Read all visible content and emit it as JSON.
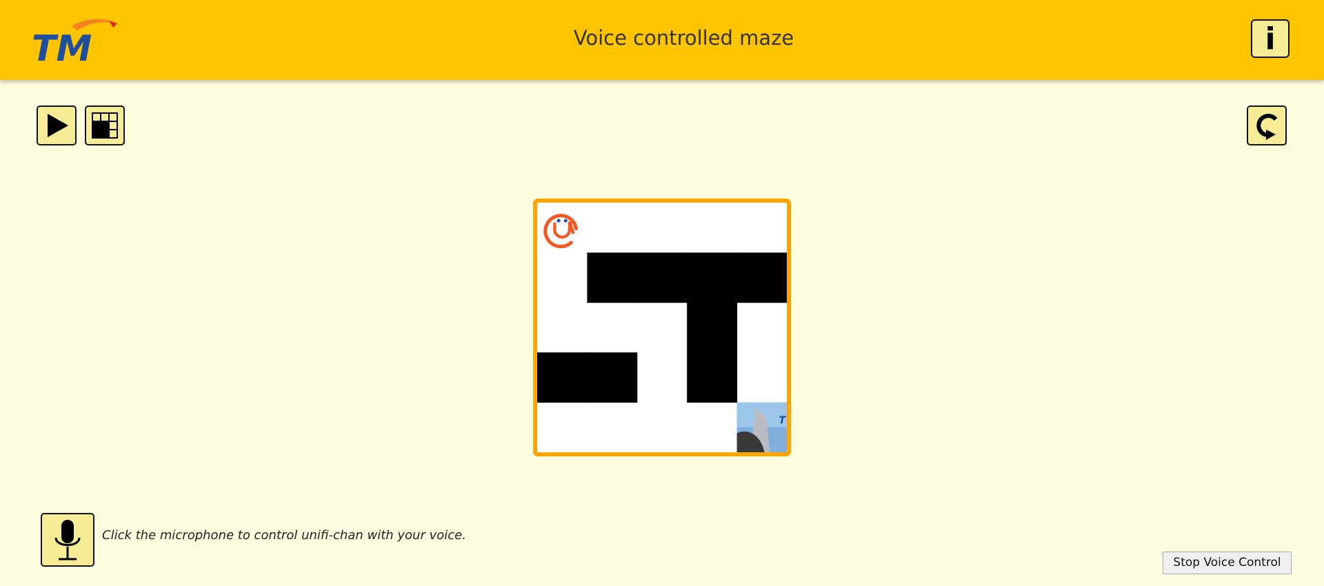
{
  "header": {
    "title": "Voice controlled maze",
    "logo_text": "TM",
    "info_label": "i",
    "background_color": "#ffc400"
  },
  "toolbar": {
    "play_icon": "play-icon",
    "grid_icon": "grid-size-icon",
    "restart_icon": "restart-icon",
    "button_color": "#f7ec96"
  },
  "maze": {
    "rows": 5,
    "cols": 5,
    "border_color": "#ffa400",
    "wall_color": "#000000",
    "walls": [
      [
        0,
        0,
        0,
        0,
        0
      ],
      [
        0,
        1,
        1,
        1,
        1
      ],
      [
        0,
        0,
        0,
        1,
        0
      ],
      [
        1,
        1,
        0,
        1,
        0
      ],
      [
        0,
        0,
        0,
        0,
        0
      ]
    ],
    "player": {
      "name": "unifi-chan",
      "row": 0,
      "col": 0,
      "icon": "unifi-chan-avatar"
    },
    "goal": {
      "row": 4,
      "col": 4,
      "icon": "tm-tower-goal-image"
    }
  },
  "voice": {
    "hint": "Click the microphone to control unifi-chan with your voice.",
    "mic_icon": "microphone-icon",
    "stop_label": "Stop Voice Control"
  }
}
